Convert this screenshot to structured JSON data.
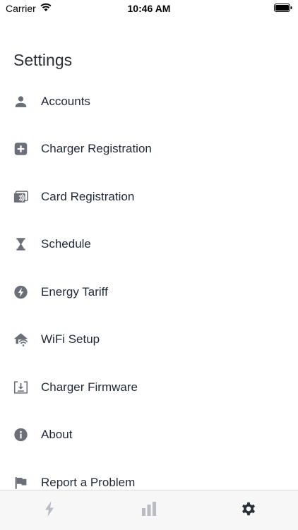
{
  "status_bar": {
    "carrier": "Carrier",
    "time": "10:46 AM"
  },
  "page": {
    "title": "Settings"
  },
  "settings": {
    "items": [
      {
        "label": "Accounts",
        "icon": "person-icon"
      },
      {
        "label": "Charger Registration",
        "icon": "plus-square-icon"
      },
      {
        "label": "Card Registration",
        "icon": "nfc-card-icon"
      },
      {
        "label": "Schedule",
        "icon": "hourglass-icon"
      },
      {
        "label": "Energy Tariff",
        "icon": "lightning-circle-icon"
      },
      {
        "label": "WiFi Setup",
        "icon": "home-wifi-icon"
      },
      {
        "label": "Charger Firmware",
        "icon": "firmware-download-icon"
      },
      {
        "label": "About",
        "icon": "info-icon"
      },
      {
        "label": "Report a Problem",
        "icon": "flag-icon"
      }
    ]
  },
  "tab_bar": {
    "tabs": [
      {
        "name": "charging",
        "icon": "lightning-icon",
        "active": false
      },
      {
        "name": "statistics",
        "icon": "bar-chart-icon",
        "active": false
      },
      {
        "name": "settings",
        "icon": "gear-icon",
        "active": true
      }
    ]
  },
  "colors": {
    "icon_gray": "#6b6f78",
    "tab_inactive": "#b9bcc3",
    "tab_active": "#2b2f3a",
    "text": "#1f2937",
    "tab_bar_bg": "#f7f7f7"
  }
}
